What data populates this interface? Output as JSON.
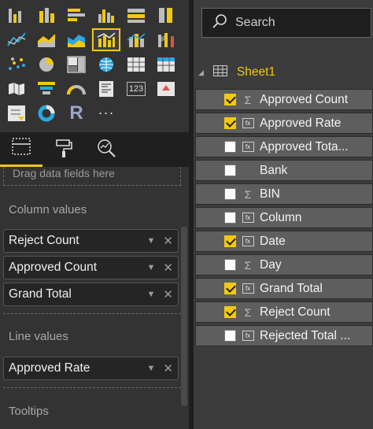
{
  "visualizations": {
    "rows": [
      [
        {
          "icon": "stacked-bar-icon"
        },
        {
          "icon": "stacked-column-icon"
        },
        {
          "icon": "clustered-bar-icon"
        },
        {
          "icon": "clustered-column-icon"
        },
        {
          "icon": "100-stacked-bar-icon"
        },
        {
          "icon": "100-stacked-column-icon"
        }
      ],
      [
        {
          "icon": "line-chart-icon"
        },
        {
          "icon": "area-chart-icon"
        },
        {
          "icon": "stacked-area-icon"
        },
        {
          "icon": "line-clustered-column-icon",
          "selected": true
        },
        {
          "icon": "line-stacked-column-icon"
        },
        {
          "icon": "ribbon-chart-icon"
        }
      ],
      [
        {
          "icon": "scatter-chart-icon"
        },
        {
          "icon": "pie-chart-icon"
        },
        {
          "icon": "treemap-icon"
        },
        {
          "icon": "map-icon"
        },
        {
          "icon": "table-icon"
        },
        {
          "icon": "matrix-icon"
        }
      ],
      [
        {
          "icon": "filled-map-icon"
        },
        {
          "icon": "funnel-icon"
        },
        {
          "icon": "gauge-icon"
        },
        {
          "icon": "multi-row-card-icon"
        },
        {
          "icon": "card-icon",
          "text": "123"
        },
        {
          "icon": "kpi-icon"
        }
      ],
      [
        {
          "icon": "slicer-icon"
        },
        {
          "icon": "donut-chart-icon"
        },
        {
          "icon": "r-visual-icon",
          "text": "R"
        },
        {
          "icon": "more-visuals-icon",
          "text": "···"
        }
      ]
    ],
    "accent": "#f2c811"
  },
  "pane_tabs": [
    {
      "name": "fields-tab-icon",
      "active": true
    },
    {
      "name": "format-paint-roller-icon",
      "active": false
    },
    {
      "name": "analytics-magnifier-icon",
      "active": false
    }
  ],
  "wells": {
    "drop_hint": "Drag data fields here",
    "column_values": {
      "title": "Column values",
      "fields": [
        "Reject Count",
        "Approved Count",
        "Grand Total"
      ]
    },
    "line_values": {
      "title": "Line values",
      "fields": [
        "Approved Rate"
      ]
    },
    "tooltips": {
      "title": "Tooltips"
    }
  },
  "fields_pane": {
    "search_placeholder": "Search",
    "table_name": "Sheet1",
    "fields": [
      {
        "label": "Approved Count",
        "checked": true,
        "type": "sigma"
      },
      {
        "label": "Approved Rate",
        "checked": true,
        "type": "calc"
      },
      {
        "label": "Approved Tota...",
        "checked": false,
        "type": "calc"
      },
      {
        "label": "Bank",
        "checked": false,
        "type": "none"
      },
      {
        "label": "BIN",
        "checked": false,
        "type": "sigma"
      },
      {
        "label": "Column",
        "checked": false,
        "type": "calc"
      },
      {
        "label": "Date",
        "checked": true,
        "type": "calc"
      },
      {
        "label": "Day",
        "checked": false,
        "type": "sigma"
      },
      {
        "label": "Grand Total",
        "checked": true,
        "type": "calc"
      },
      {
        "label": "Reject Count",
        "checked": true,
        "type": "sigma"
      },
      {
        "label": "Rejected Total ...",
        "checked": false,
        "type": "calc"
      }
    ]
  }
}
